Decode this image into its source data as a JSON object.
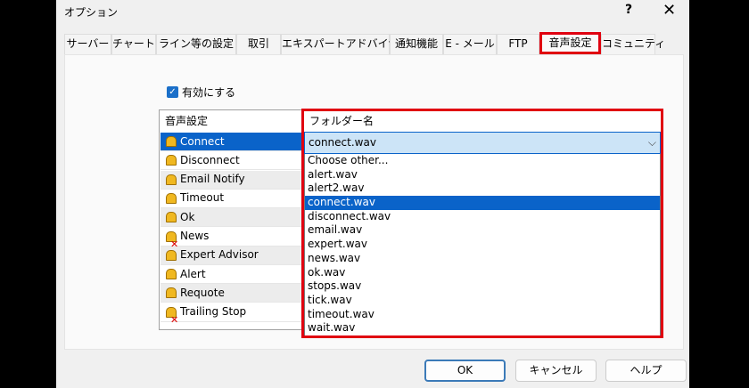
{
  "window": {
    "title": "オプション",
    "help": "?",
    "close": "✕"
  },
  "tabs": [
    "サーバー",
    "チャート",
    "ライン等の設定",
    "取引",
    "エキスパートアドバイザ",
    "通知機能",
    "E - メール",
    "FTP",
    "音声設定",
    "コミュニティ"
  ],
  "active_tab": "音声設定",
  "enable": {
    "label": "有効にする",
    "checked": true
  },
  "table": {
    "headers": [
      "音声設定",
      "フォルダー名"
    ],
    "events": [
      {
        "name": "Connect",
        "icon": "bell-icon"
      },
      {
        "name": "Disconnect",
        "icon": "bell-icon"
      },
      {
        "name": "Email Notify",
        "icon": "bell-icon"
      },
      {
        "name": "Timeout",
        "icon": "bell-icon"
      },
      {
        "name": "Ok",
        "icon": "bell-icon"
      },
      {
        "name": "News",
        "icon": "bell-disabled-icon"
      },
      {
        "name": "Expert Advisor",
        "icon": "bell-icon"
      },
      {
        "name": "Alert",
        "icon": "bell-icon"
      },
      {
        "name": "Requote",
        "icon": "bell-icon"
      },
      {
        "name": "Trailing Stop",
        "icon": "bell-disabled-icon"
      }
    ],
    "selected_event": "Connect"
  },
  "combo": {
    "value": "connect.wav",
    "options": [
      "Choose other...",
      "alert.wav",
      "alert2.wav",
      "connect.wav",
      "disconnect.wav",
      "email.wav",
      "expert.wav",
      "news.wav",
      "ok.wav",
      "stops.wav",
      "tick.wav",
      "timeout.wav",
      "wait.wav"
    ]
  },
  "buttons": {
    "ok": "OK",
    "cancel": "キャンセル",
    "help": "ヘルプ"
  },
  "colors": {
    "highlight": "#e00010",
    "selection": "#0a63c9"
  }
}
